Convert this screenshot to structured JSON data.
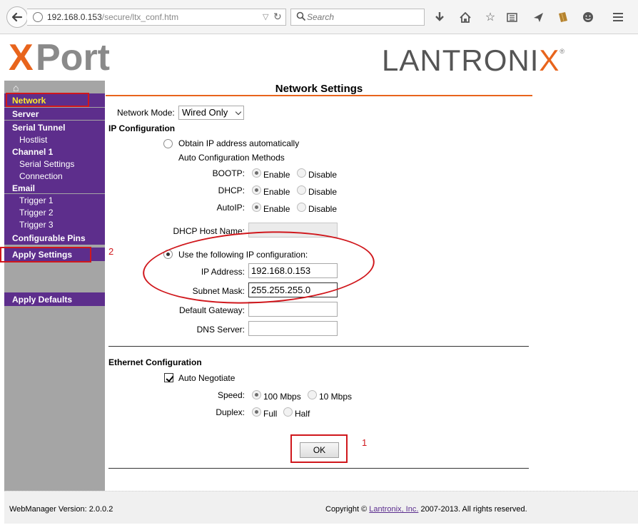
{
  "browser": {
    "url_host": "192.168.0.153",
    "url_path": "/secure/ltx_conf.htm",
    "search_placeholder": "Search",
    "toolbar_icons": [
      "download-icon",
      "home-icon",
      "bookmark-star-icon",
      "reading-list-icon",
      "send-icon",
      "extension-icon",
      "smiley-icon",
      "menu-icon"
    ]
  },
  "header": {
    "logo_left": "XPort",
    "logo_right_a": "LANTRONI",
    "logo_right_x": "X",
    "logo_right_reg": "®"
  },
  "sidebar": {
    "network": "Network",
    "server": "Server",
    "serial_tunnel": "Serial Tunnel",
    "hostlist": "Hostlist",
    "channel1": "Channel 1",
    "serial_settings": "Serial Settings",
    "connection": "Connection",
    "email": "Email",
    "trigger1": "Trigger 1",
    "trigger2": "Trigger 2",
    "trigger3": "Trigger 3",
    "configurable_pins": "Configurable Pins",
    "apply_settings": "Apply Settings",
    "apply_defaults": "Apply Defaults"
  },
  "page": {
    "title": "Network Settings",
    "network_mode_label": "Network Mode:",
    "network_mode_value": "Wired Only",
    "ip_config_heading": "IP Configuration",
    "obtain_auto_label": "Obtain IP address automatically",
    "auto_methods_label": "Auto Configuration Methods",
    "bootp_label": "BOOTP:",
    "dhcp_label": "DHCP:",
    "autoip_label": "AutoIP:",
    "enable_label": "Enable",
    "disable_label": "Disable",
    "dhcp_host_label": "DHCP Host Name:",
    "use_following_label": "Use the following IP configuration:",
    "ip_address_label": "IP Address:",
    "ip_address_value": "192.168.0.153",
    "subnet_label": "Subnet Mask:",
    "subnet_value": "255.255.255.0",
    "gateway_label": "Default Gateway:",
    "dns_label": "DNS Server:",
    "ethernet_heading": "Ethernet Configuration",
    "auto_negotiate_label": "Auto Negotiate",
    "speed_label": "Speed:",
    "speed_100": "100 Mbps",
    "speed_10": "10 Mbps",
    "duplex_label": "Duplex:",
    "duplex_full": "Full",
    "duplex_half": "Half",
    "ok_label": "OK"
  },
  "footer": {
    "version": "WebManager Version: 2.0.0.2",
    "copyright_prefix": "Copyright © ",
    "copyright_link": "Lantronix, Inc.",
    "copyright_suffix": " 2007-2013. All rights reserved."
  },
  "annotations": {
    "step1": "1",
    "step2": "2"
  },
  "colors": {
    "accent_orange": "#e8641c",
    "sidebar_purple": "#5d2e8c",
    "sidebar_gray": "#a5a5a5",
    "selected_yellow": "#ffea2c",
    "annotation_red": "#d0171c"
  }
}
